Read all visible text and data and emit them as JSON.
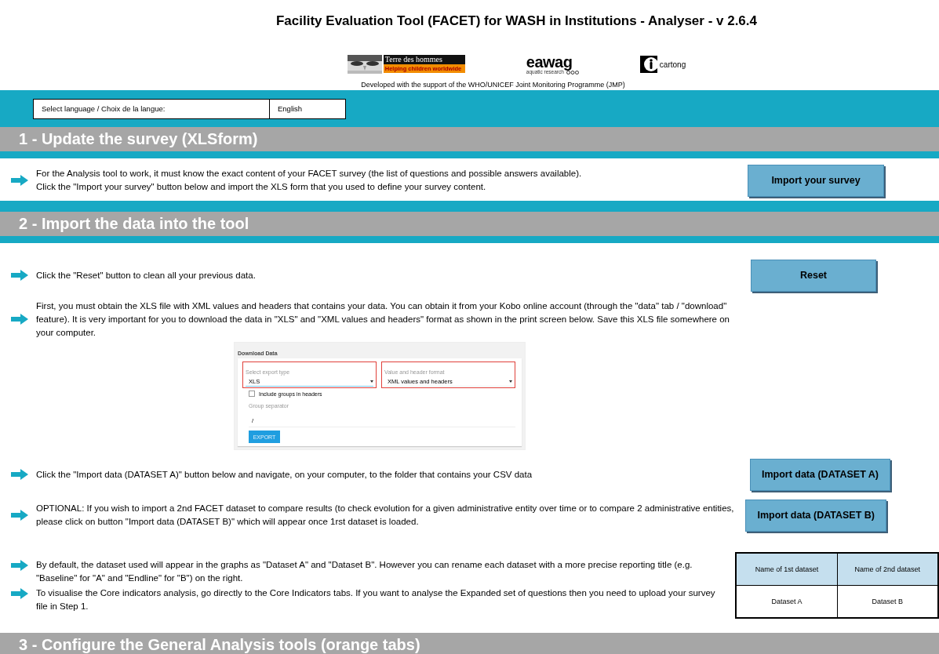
{
  "title": "Facility Evaluation Tool (FACET) for WASH in Institutions - Analyser - v 2.6.4",
  "logos": [
    {
      "kind": "tdh",
      "name": "Terre des hommes",
      "tagline": "Helping children worldwide"
    },
    {
      "kind": "eawag",
      "name": "eawag",
      "tagline": "aquatic research"
    },
    {
      "kind": "cartong",
      "name": "cartong"
    }
  ],
  "support_note": "Developed with the support of the WHO/UNICEF Joint Monitoring Programme (JMP)",
  "language": {
    "label": "Select language / Choix de la langue:",
    "value": "English"
  },
  "sections": [
    {
      "title": "1 - Update the survey (XLSform)",
      "steps": [
        {
          "kind": "text",
          "text": "For the Analysis tool to work, it must know the exact content of your FACET survey (the list of questions and possible answers available).\nClick the \"Import your survey\" button  below and import the XLS form that you used to define your survey content.",
          "button": "Import your survey"
        }
      ]
    },
    {
      "title": "2 - Import the data into the tool",
      "steps": [
        {
          "kind": "text",
          "text": "Click the \"Reset\" button to clean all your previous data.",
          "button": "Reset"
        },
        {
          "kind": "text",
          "text": "First, you must obtain the XLS file with XML values and headers that contains your data. You can obtain it from your Kobo online account (through the \"data\" tab / \"download\" feature).  It is very important for you to download the data in \"XLS\" and \"XML values and headers\" format as shown in the print screen below. Save this XLS file somewhere on your computer."
        },
        {
          "kind": "screenshot",
          "heading": "Download Data",
          "fields": [
            {
              "label": "Select export type",
              "value": "XLS",
              "highlighted": true
            },
            {
              "label": "Value and header format",
              "value": "XML values and headers",
              "highlighted": true
            }
          ],
          "checkbox": {
            "label": "Include groups in headers",
            "checked": false
          },
          "separator": {
            "label": "Group separator",
            "value": "/"
          },
          "button": "EXPORT"
        },
        {
          "kind": "text",
          "text": "Click the \"Import data (DATASET A)\" button below and navigate, on your computer, to the folder that contains your CSV data",
          "button": "Import data (DATASET A)"
        },
        {
          "kind": "text",
          "text": "OPTIONAL: If you wish to import a 2nd FACET dataset to compare results (to check evolution for a given administrative entity over time or to compare 2 administrative entities, please click on button \"Import data (DATASET B)\" which will appear once 1rst dataset is loaded.",
          "button": "Import data (DATASET B)"
        },
        {
          "kind": "datasets",
          "texts": [
            "By default, the dataset used will appear in the graphs as \"Dataset A\" and \"Dataset B\". However you can rename each dataset with a more precise reporting title (e.g. \"Baseline\" for \"A\" and \"Endline\" for \"B\") on the right.",
            "To visualise the Core indicators analysis, go directly to the Core Indicators tabs. If you want to analyse the Expanded set of questions then you need to upload your survey file in Step 1."
          ],
          "table": {
            "columns": [
              "Name of 1st dataset",
              "Name of 2nd dataset"
            ],
            "values": [
              "Dataset A",
              "Dataset B"
            ]
          }
        }
      ]
    },
    {
      "title": "3 - Configure the General Analysis tools (orange tabs)"
    }
  ]
}
